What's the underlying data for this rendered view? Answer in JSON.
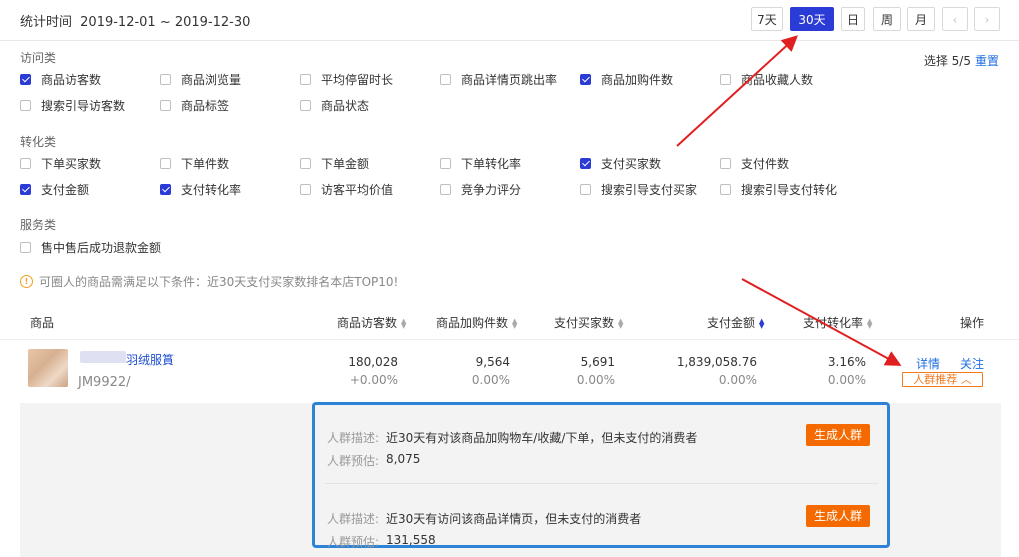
{
  "header": {
    "stat_label": "统计时间",
    "date_range": "2019-12-01 ~ 2019-12-30",
    "range_buttons": [
      "7天",
      "30天",
      "日",
      "周",
      "月"
    ],
    "active_range": "30天",
    "prev_icon": "chevron-left-icon",
    "next_icon": "chevron-right-icon"
  },
  "selection": {
    "count_text": "选择 5/5",
    "reset_label": "重置"
  },
  "sections": [
    {
      "title": "访问类",
      "items": [
        {
          "label": "商品访客数",
          "checked": true
        },
        {
          "label": "商品浏览量",
          "checked": false
        },
        {
          "label": "平均停留时长",
          "checked": false
        },
        {
          "label": "商品详情页跳出率",
          "checked": false
        },
        {
          "label": "商品加购件数",
          "checked": true
        },
        {
          "label": "商品收藏人数",
          "checked": false
        },
        {
          "label": "搜索引导访客数",
          "checked": false
        },
        {
          "label": "商品标签",
          "checked": false
        },
        {
          "label": "商品状态",
          "checked": false
        }
      ]
    },
    {
      "title": "转化类",
      "items": [
        {
          "label": "下单买家数",
          "checked": false
        },
        {
          "label": "下单件数",
          "checked": false
        },
        {
          "label": "下单金额",
          "checked": false
        },
        {
          "label": "下单转化率",
          "checked": false
        },
        {
          "label": "支付买家数",
          "checked": true
        },
        {
          "label": "支付件数",
          "checked": false
        },
        {
          "label": "支付金额",
          "checked": true
        },
        {
          "label": "支付转化率",
          "checked": true
        },
        {
          "label": "访客平均价值",
          "checked": false
        },
        {
          "label": "竞争力评分",
          "checked": false
        },
        {
          "label": "搜索引导支付买家",
          "checked": false
        },
        {
          "label": "搜索引导支付转化",
          "checked": false
        }
      ]
    },
    {
      "title": "服务类",
      "items": [
        {
          "label": "售中售后成功退款金额",
          "checked": false
        }
      ]
    }
  ],
  "notice": "可圈人的商品需满足以下条件：近30天支付买家数排名本店TOP10!",
  "table": {
    "columns": [
      "商品",
      "商品访客数",
      "商品加购件数",
      "支付买家数",
      "支付金额",
      "支付转化率",
      "操作"
    ],
    "sorted_column": "支付金额",
    "row": {
      "name": "羽绒服篔",
      "code": "JM9922/",
      "visitors": "180,028",
      "visitors_change": "+0.00%",
      "cart": "9,564",
      "cart_change": "0.00%",
      "buyers": "5,691",
      "buyers_change": "0.00%",
      "amount": "1,839,058.76",
      "amount_change": "0.00%",
      "rate": "3.16%",
      "rate_change": "0.00%",
      "action_detail": "详情",
      "action_follow": "关注",
      "action_crowd": "人群推荐"
    }
  },
  "crowd": {
    "desc_label": "人群描述:",
    "est_label": "人群预估:",
    "button_label": "生成人群",
    "items": [
      {
        "desc": "近30天有对该商品加购物车/收藏/下单，但未支付的消费者",
        "estimate": "8,075"
      },
      {
        "desc": "近30天有访问该商品详情页，但未支付的消费者",
        "estimate": "131,558"
      }
    ]
  },
  "colors": {
    "accent": "#2b3bd6",
    "link": "#1f6fe0",
    "orange": "#f56a00",
    "highlight_box": "#2d83d6",
    "arrow": "#e02020"
  }
}
